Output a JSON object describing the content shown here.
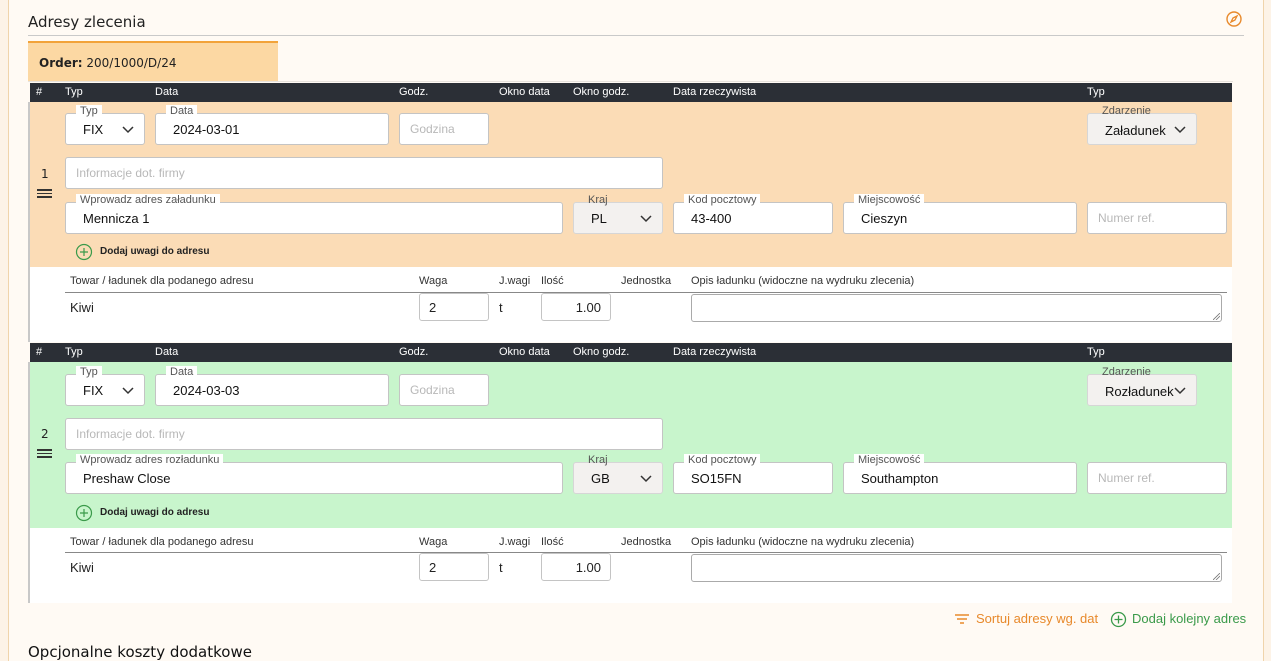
{
  "section": {
    "title": "Adresy zlecenia",
    "edit_icon": "compass-icon"
  },
  "tab": {
    "label_bold": "Order:",
    "label_value": "200/1000/D/24"
  },
  "columns": [
    "#",
    "Typ",
    "Data",
    "Godz.",
    "Okno data",
    "Okno godz.",
    "Data rzeczywista",
    "Typ"
  ],
  "addresses": [
    {
      "index": "1",
      "type_label": "Typ",
      "type_value": "FIX",
      "date_label": "Data",
      "date_value": "2024-03-01",
      "time_placeholder": "Godzina",
      "event_label": "Zdarzenie",
      "event_value": "Załadunek",
      "company_placeholder": "Informacje dot. firmy",
      "address_label": "Wprowadz adres załadunku",
      "address_value": "Mennicza 1",
      "country_label": "Kraj",
      "country_value": "PL",
      "postal_label": "Kod pocztowy",
      "postal_value": "43-400",
      "city_label": "Miejscowość",
      "city_value": "Cieszyn",
      "ref_placeholder": "Numer ref.",
      "add_note": "Dodaj uwagi do adresu",
      "bg_color": "#fbdcb6",
      "cargo": {
        "headers": [
          "Towar / ładunek dla podanego adresu",
          "Waga",
          "J.wagi",
          "Ilość",
          "Jednostka",
          "Opis ładunku (widoczne na wydruku zlecenia)"
        ],
        "name": "Kiwi",
        "weight": "2",
        "weight_unit": "t",
        "quantity": "1.00",
        "unit": "",
        "description": ""
      }
    },
    {
      "index": "2",
      "type_label": "Typ",
      "type_value": "FIX",
      "date_label": "Data",
      "date_value": "2024-03-03",
      "time_placeholder": "Godzina",
      "event_label": "Zdarzenie",
      "event_value": "Rozładunek",
      "company_placeholder": "Informacje dot. firmy",
      "address_label": "Wprowadz adres rozładunku",
      "address_value": "Preshaw Close",
      "country_label": "Kraj",
      "country_value": "GB",
      "postal_label": "Kod pocztowy",
      "postal_value": "SO15FN",
      "city_label": "Miejscowość",
      "city_value": "Southampton",
      "ref_placeholder": "Numer ref.",
      "add_note": "Dodaj uwagi do adresu",
      "bg_color": "#c8f5cc",
      "cargo": {
        "headers": [
          "Towar / ładunek dla podanego adresu",
          "Waga",
          "J.wagi",
          "Ilość",
          "Jednostka",
          "Opis ładunku (widoczne na wydruku zlecenia)"
        ],
        "name": "Kiwi",
        "weight": "2",
        "weight_unit": "t",
        "quantity": "1.00",
        "unit": "",
        "description": ""
      }
    }
  ],
  "actions": {
    "sort": "Sortuj adresy wg. dat",
    "add": "Dodaj kolejny adres"
  },
  "colors": {
    "accent_orange": "#e8892b",
    "accent_green": "#3a9a4a"
  },
  "next_section": {
    "title": "Opcjonalne koszty dodatkowe"
  }
}
